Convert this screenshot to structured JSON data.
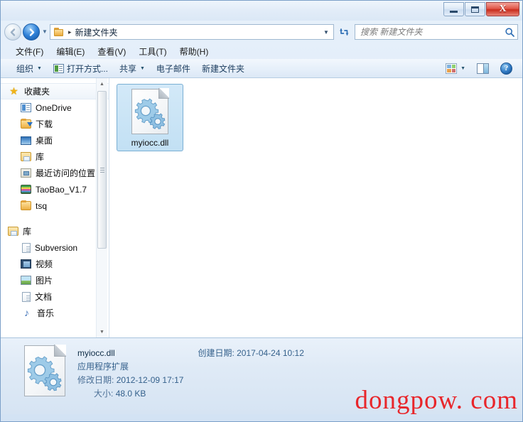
{
  "window": {
    "controls": {
      "minimize": "–",
      "maximize": "□",
      "close": "X"
    }
  },
  "address": {
    "back_icon": "back-arrow-icon",
    "forward_icon": "forward-arrow-icon",
    "history_caret": "▼",
    "breadcrumb_sep": "▸",
    "crumb": "新建文件夹",
    "dropdown_caret": "▼",
    "refresh_icon": "refresh-icon"
  },
  "search": {
    "placeholder": "搜索 新建文件夹",
    "value": "",
    "icon": "search-icon"
  },
  "menubar": {
    "items": [
      {
        "label": "文件(F)"
      },
      {
        "label": "编辑(E)"
      },
      {
        "label": "查看(V)"
      },
      {
        "label": "工具(T)"
      },
      {
        "label": "帮助(H)"
      }
    ]
  },
  "toolbar": {
    "organize": "组织",
    "open_with": "打开方式...",
    "share": "共享",
    "email": "电子邮件",
    "new_folder": "新建文件夹",
    "caret": "▼",
    "help_glyph": "?"
  },
  "sidebar": {
    "sections": [
      {
        "header": {
          "label": "收藏夹",
          "icon": "star-icon"
        },
        "items": [
          {
            "label": "OneDrive",
            "icon": "onedrive-icon"
          },
          {
            "label": "下载",
            "icon": "downloads-folder-icon"
          },
          {
            "label": "桌面",
            "icon": "desktop-icon"
          },
          {
            "label": "库",
            "icon": "library-icon"
          },
          {
            "label": "最近访问的位置",
            "icon": "recent-places-icon"
          },
          {
            "label": "TaoBao_V1.7",
            "icon": "archive-icon"
          },
          {
            "label": "tsq",
            "icon": "folder-icon"
          }
        ]
      },
      {
        "header": {
          "label": "库",
          "icon": "library-icon"
        },
        "items": [
          {
            "label": "Subversion",
            "icon": "document-icon"
          },
          {
            "label": "视频",
            "icon": "video-icon"
          },
          {
            "label": "图片",
            "icon": "picture-icon"
          },
          {
            "label": "文档",
            "icon": "document-icon"
          },
          {
            "label": "音乐",
            "icon": "music-note-icon"
          }
        ]
      }
    ],
    "scroll_up": "▲",
    "scroll_down": "▼"
  },
  "content": {
    "file": {
      "name": "myiocc.dll",
      "icon": "dll-gears-icon",
      "selected": true
    }
  },
  "details": {
    "icon": "dll-gears-icon",
    "name": "myiocc.dll",
    "type": "应用程序扩展",
    "modified_key": "修改日期:",
    "modified_value": "2012-12-09 17:17",
    "size_key": "大小:",
    "size_value": "48.0 KB",
    "created_key": "创建日期:",
    "created_value": "2017-04-24 10:12"
  },
  "watermark": {
    "text": "dongpow. com",
    "color": "#e8262b"
  }
}
